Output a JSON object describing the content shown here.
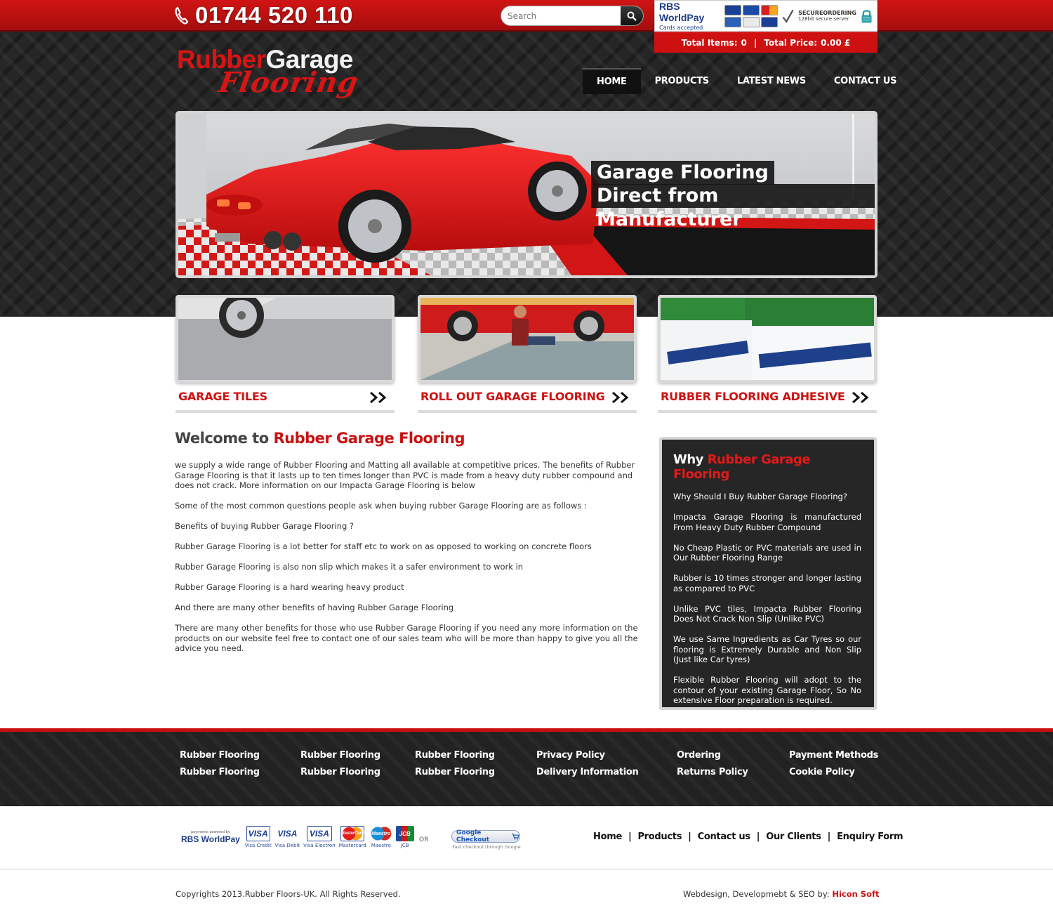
{
  "header": {
    "phone": "01744 520 110",
    "search_placeholder": "Search",
    "payment_badge": {
      "provider": "RBS WorldPay",
      "cards_accepted": "Cards accepted",
      "secure_title": "SECUREORDERING",
      "secure_sub": "128bit secure server"
    },
    "cart": {
      "items_label": "Total Items:",
      "items_value": "0",
      "price_label": "Total Price:",
      "price_value": "0.00 £"
    }
  },
  "logo": {
    "word1": "Rubber",
    "word2": "Garage",
    "word3": "Flooring"
  },
  "nav": [
    {
      "label": "HOME",
      "active": true
    },
    {
      "label": "PRODUCTS"
    },
    {
      "label": "LATEST NEWS"
    },
    {
      "label": "CONTACT US"
    }
  ],
  "hero": {
    "line1": "Garage Flooring",
    "line2": "Direct from Manufacturer"
  },
  "categories": [
    {
      "title": "GARAGE TILES"
    },
    {
      "title": "ROLL OUT GARAGE FLOORING"
    },
    {
      "title": "RUBBER FLOORING ADHESIVE"
    }
  ],
  "welcome": {
    "title_plain": "Welcome to",
    "title_red": "Rubber Garage Flooring",
    "paragraphs": [
      "we supply a wide range of Rubber Flooring and Matting all available at competitive prices. The benefits of Rubber Garage Flooring is that it lasts up to ten times longer than PVC is made from a heavy duty rubber compound and does not crack. More information on our Impacta Garage Flooring is below",
      "Some of the most common questions people ask when buying rubber Garage Flooring are as follows :",
      "Benefits of buying Rubber Garage Flooring ?",
      "Rubber Garage Flooring is a lot better for staff etc to work on as opposed to working on concrete floors",
      "Rubber Garage Flooring is also non slip which makes it a safer environment to work in",
      "Rubber Garage Flooring is a hard wearing heavy product",
      "And there are many other benefits of having Rubber Garage Flooring",
      "There are many other benefits for those who use Rubber Garage Flooring if you need any more information on the products on our website feel free to contact one of our sales team who will be more than happy to give you all the advice you need."
    ]
  },
  "why": {
    "title_plain": "Why",
    "title_red": "Rubber Garage Flooring",
    "items": [
      "Why Should I Buy Rubber Garage Flooring?",
      "Impacta Garage Flooring is manufactured From Heavy Duty Rubber Compound",
      "No Cheap Plastic or PVC materials are used in Our Rubber Flooring Range",
      "Rubber is 10 times stronger and longer lasting as compared to PVC",
      "Unlike PVC tiles, Impacta Rubber Flooring Does Not Crack Non Slip (Unlike PVC)",
      "We use Same Ingredients as Car Tyres so our flooring is Extremely Durable and Non Slip (Just like Car tyres)",
      "Flexible Rubber Flooring will adopt to the contour of your existing Garage Floor, So No extensive Floor preparation is required."
    ]
  },
  "footer_links": [
    [
      "Rubber Flooring",
      "Rubber Flooring"
    ],
    [
      "Rubber Flooring",
      "Rubber Flooring"
    ],
    [
      "Rubber Flooring",
      "Rubber Flooring"
    ],
    [
      "Privacy Policy",
      "Delivery Information"
    ],
    [
      "Ordering",
      "Returns Policy"
    ],
    [
      "Payment Methods",
      "Cookie Policy"
    ]
  ],
  "payments": {
    "powered_by": "payments powered by",
    "provider": "RBS WorldPay",
    "cards": [
      {
        "label": "VISA",
        "caption": "Visa Credit"
      },
      {
        "label": "VISA",
        "caption": "Visa Debit"
      },
      {
        "label": "VISA",
        "caption": "Visa Electron"
      },
      {
        "label": "MasterCard",
        "caption": "Mastercard"
      },
      {
        "label": "Maestro",
        "caption": "Maestro"
      },
      {
        "label": "JCB",
        "caption": "JCB"
      }
    ],
    "or": "OR",
    "google_checkout": "Google Checkout",
    "google_sub": "Fast checkout through Google"
  },
  "bottom_nav": [
    "Home",
    "Products",
    "Contact us",
    "Our Clients",
    "Enquiry Form"
  ],
  "copyright": "Copyrights 2013.Rubber Floors-UK. All Rights Reserved.",
  "credit": {
    "text": "Webdesign, Developmebt & SEO by:",
    "link": "Hicon Soft"
  },
  "colors": {
    "brand_red": "#c91212",
    "dark_bg": "#262626"
  }
}
